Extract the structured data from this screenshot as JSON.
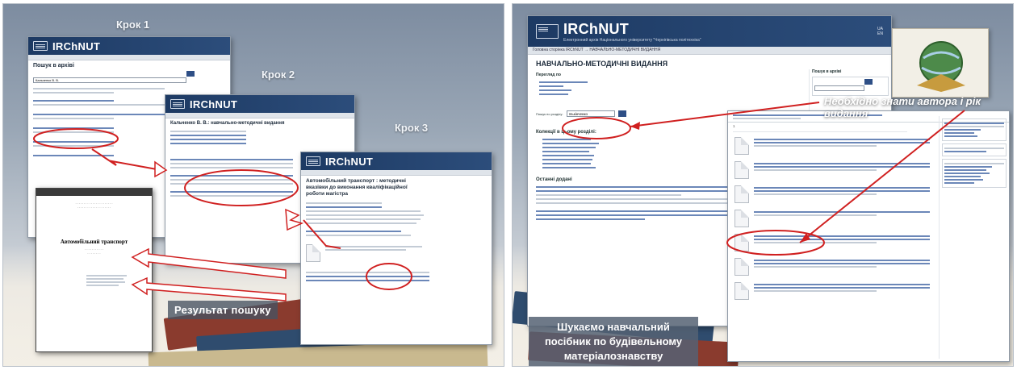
{
  "left_slide": {
    "step1": "Крок 1",
    "step2": "Крок 2",
    "step3": "Крок 3",
    "result_label": "Результат пошуку",
    "win1": {
      "brand": "IRChNUT",
      "title": "Пошук в архіві",
      "query": "Кальченко В. В."
    },
    "win2": {
      "brand": "IRChNUT",
      "title": "Кальченко В. В.: навчально-методичні видання"
    },
    "win3": {
      "brand": "IRChNUT",
      "title": "Автомобільний транспорт : методичні вказівки до виконання кваліфікаційної роботи магістра"
    },
    "doc": {
      "title": "Автомобільний транспорт"
    }
  },
  "right_slide": {
    "brand": "IRChNUT",
    "subtitle": "Електронний архів Національного університету \"Чернігівська політехніка\"",
    "breadcrumb": "Головна сторінка IRChNUT → НАВЧАЛЬНО-МЕТОДИЧНІ ВИДАННЯ",
    "page_title": "НАВЧАЛЬНО-МЕТОДИЧНІ ВИДАННЯ",
    "browse_label": "Перегляд по",
    "search_side": "Пошук в архіві",
    "query": "Ількінченко",
    "collections_title": "Колекції в цьому розділі:",
    "recent_title": "Останні додані",
    "note": "Необхідно знати автора і рік видання",
    "caption": "Шукаємо навчальний посібник по будівельному матеріалознавству"
  }
}
